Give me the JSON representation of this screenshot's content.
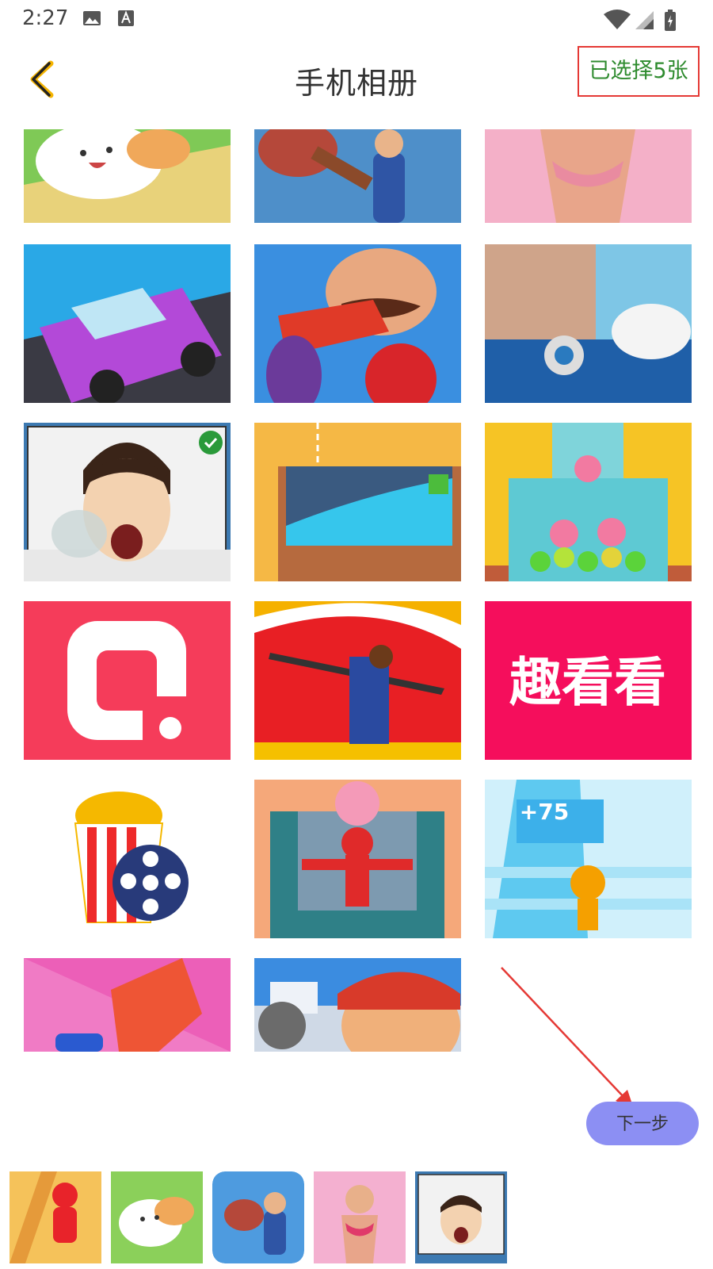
{
  "status_bar": {
    "time": "2:27",
    "icons": [
      "image-icon",
      "a-font-icon",
      "wifi-icon",
      "cellular-icon",
      "battery-icon"
    ]
  },
  "header": {
    "back_icon": "chevron-left-icon",
    "title": "手机相册",
    "selected_label": "已选择5张"
  },
  "grid": {
    "tiles": [
      {
        "name": "sushi-game",
        "selected": false
      },
      {
        "name": "hammer-policeman-game",
        "selected": false
      },
      {
        "name": "bikini-body-game",
        "selected": false
      },
      {
        "name": "purple-car-race-game",
        "selected": false
      },
      {
        "name": "chef-vegetables-game",
        "selected": false
      },
      {
        "name": "dirty-bathroom-game",
        "selected": false
      },
      {
        "name": "sleeping-man-game",
        "selected": true
      },
      {
        "name": "sand-water-pipe-game",
        "selected": false
      },
      {
        "name": "ball-bottle-game",
        "selected": false
      },
      {
        "name": "red-q-app-logo",
        "selected": false
      },
      {
        "name": "sword-slash-game",
        "selected": false
      },
      {
        "name": "qukankan-logo",
        "selected": false,
        "text": "趣看看"
      },
      {
        "name": "popcorn-film-logo",
        "selected": false
      },
      {
        "name": "balloon-robot-game",
        "selected": false
      },
      {
        "name": "runner-stairs-game",
        "selected": false,
        "text": "+75"
      },
      {
        "name": "fist-fight-game",
        "selected": false
      },
      {
        "name": "subway-surfer-game",
        "selected": false
      }
    ]
  },
  "next_button": {
    "label": "下一步"
  },
  "selected_tray": {
    "items": [
      "slingshot-stickman-game",
      "sushi-game",
      "hammer-policeman-game",
      "muscle-woman-game",
      "sleeping-man-game"
    ]
  },
  "colors": {
    "accent_border": "#e53935",
    "selected_text": "#2e8b2e",
    "next_button": "#8c8ff3",
    "check_badge": "#2a9a3a",
    "arrow": "#e53935"
  }
}
